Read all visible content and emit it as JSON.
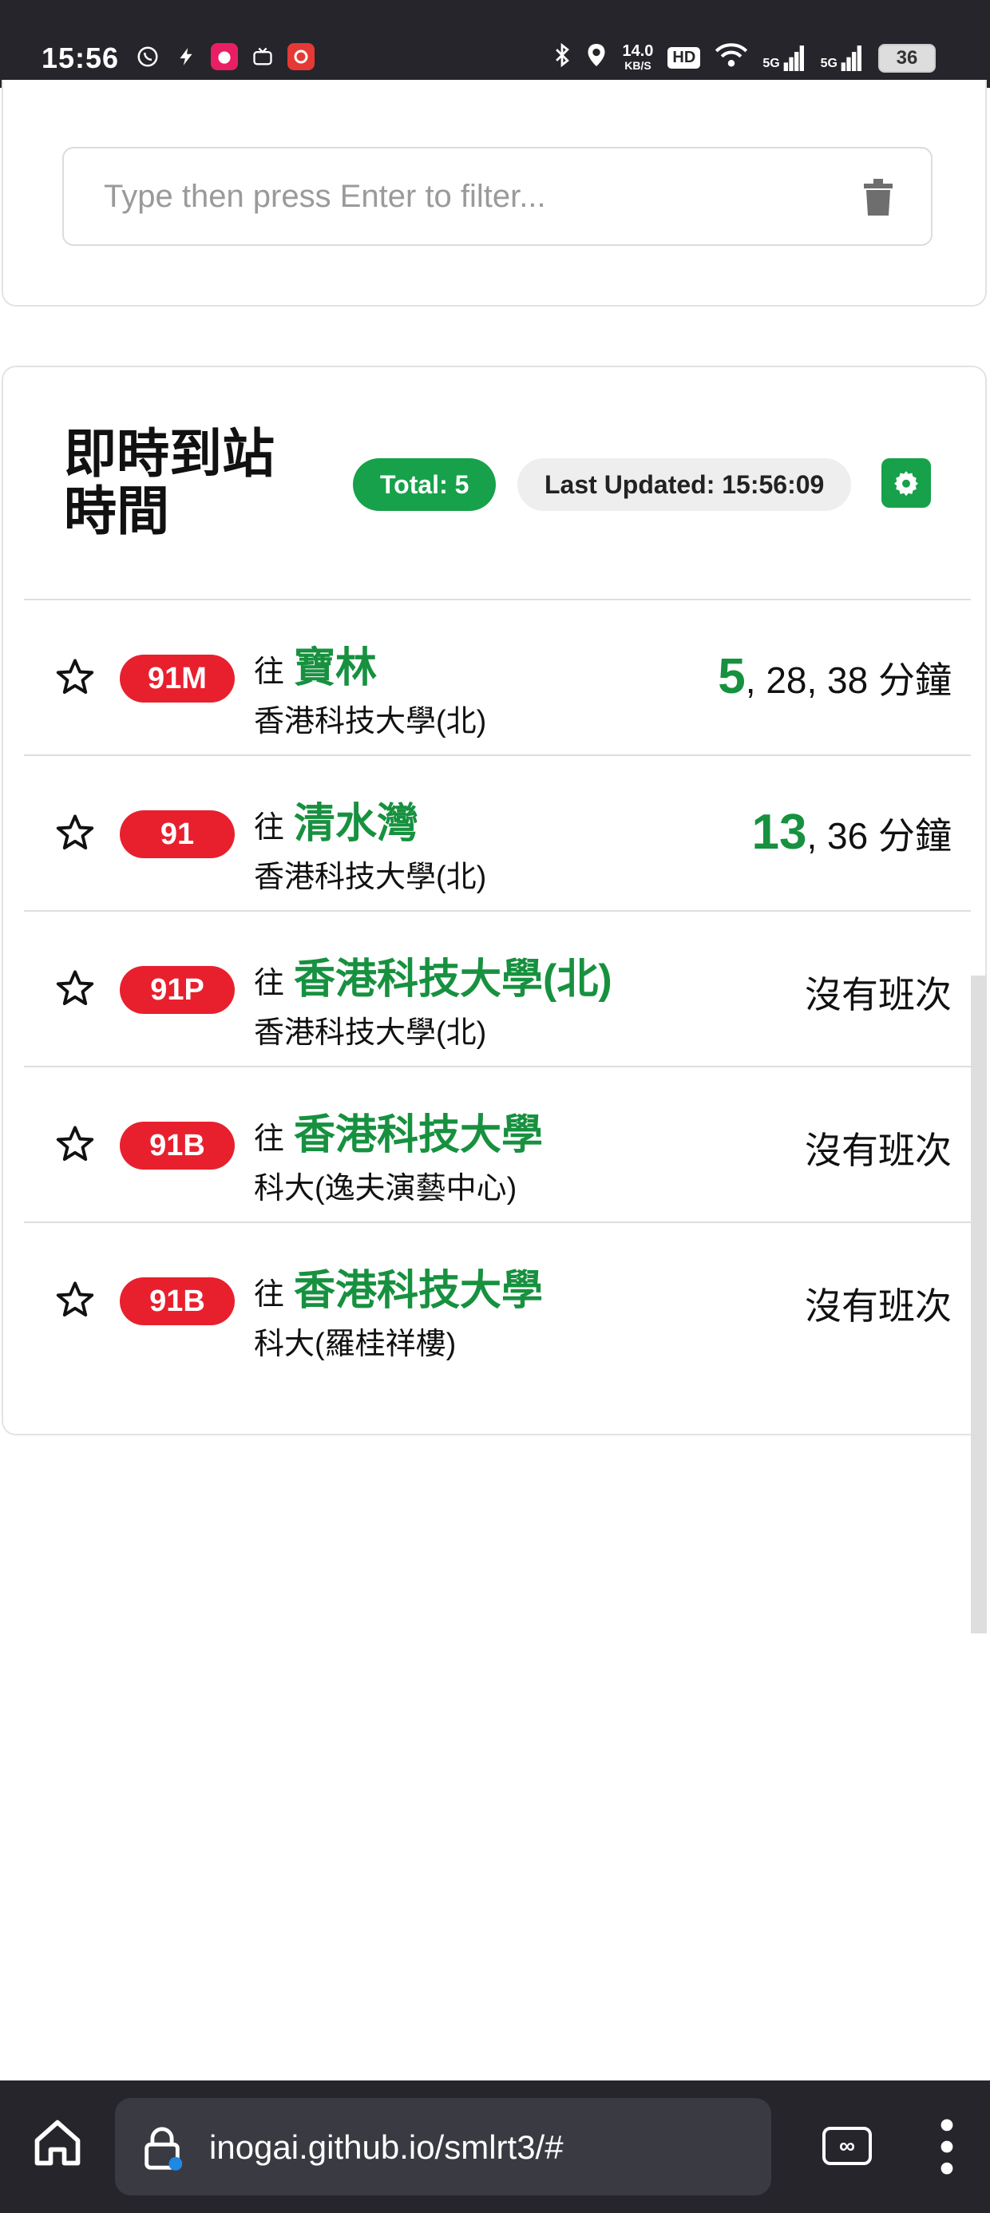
{
  "status_bar": {
    "time": "15:56",
    "net_speed_value": "14.0",
    "net_speed_unit": "KB/S",
    "hd": "HD",
    "signal1": "5G",
    "signal2": "5G",
    "battery": "36"
  },
  "filter": {
    "placeholder": "Type then press Enter to filter..."
  },
  "eta": {
    "title": "即時到站時間",
    "total": "Total: 5",
    "last_updated": "Last Updated: 15:56:09",
    "to_label": "往",
    "rows": [
      {
        "route": "91M",
        "destination": "寶林",
        "stop": "香港科技大學(北)",
        "eta_first": "5",
        "eta_rest": ", 28, 38 分鐘",
        "eta_none": ""
      },
      {
        "route": "91",
        "destination": "清水灣",
        "stop": "香港科技大學(北)",
        "eta_first": "13",
        "eta_rest": ", 36 分鐘",
        "eta_none": ""
      },
      {
        "route": "91P",
        "destination": "香港科技大學(北)",
        "stop": "香港科技大學(北)",
        "eta_first": "",
        "eta_rest": "",
        "eta_none": "沒有班次"
      },
      {
        "route": "91B",
        "destination": "香港科技大學",
        "stop": "科大(逸夫演藝中心)",
        "eta_first": "",
        "eta_rest": "",
        "eta_none": "沒有班次"
      },
      {
        "route": "91B",
        "destination": "香港科技大學",
        "stop": "科大(羅桂祥樓)",
        "eta_first": "",
        "eta_rest": "",
        "eta_none": "沒有班次"
      }
    ]
  },
  "browser": {
    "url": "inogai.github.io/smlrt3/#",
    "tabs_icon": "∞"
  },
  "colors": {
    "accent_green": "#17a14a",
    "route_red": "#e8202e"
  }
}
